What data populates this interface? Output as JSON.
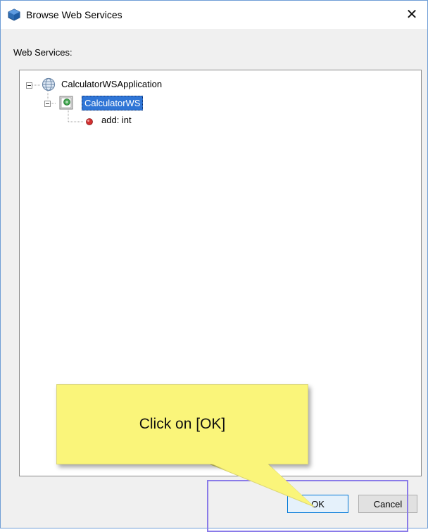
{
  "window": {
    "title": "Browse Web Services",
    "close_glyph": "✕"
  },
  "section_label": "Web Services:",
  "tree": {
    "application": {
      "label": "CalculatorWSApplication",
      "icon": "globe-icon"
    },
    "service": {
      "label": "CalculatorWS",
      "icon": "web-service-icon",
      "selected": true
    },
    "operation": {
      "label": "add: int",
      "icon": "red-dot-icon"
    }
  },
  "buttons": {
    "ok": "OK",
    "cancel": "Cancel"
  },
  "callout": {
    "text": "Click on [OK]"
  },
  "colors": {
    "selection": "#2f75d6",
    "callout": "#faf57a",
    "highlight_box": "#8a7be8",
    "window_border": "#6f9ed6"
  }
}
